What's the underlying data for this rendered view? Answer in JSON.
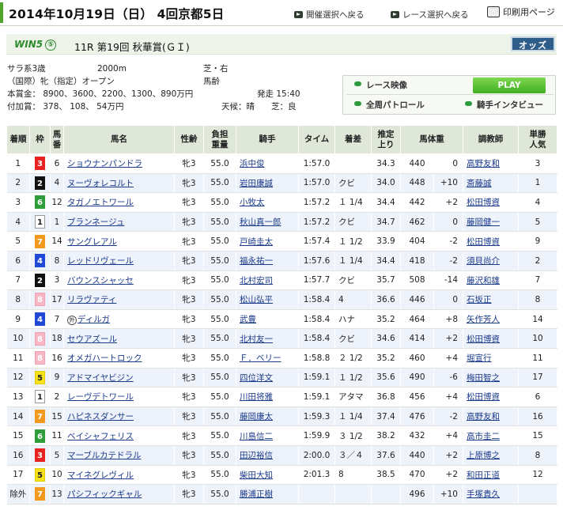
{
  "header": {
    "title": "2014年10月19日（日） 4回京都5日",
    "nav": [
      "開催選択へ戻る",
      "レース選択へ戻る"
    ],
    "print_label": "印刷用ページ"
  },
  "race": {
    "win5_label": "WIN5",
    "win5_num": "⑤",
    "name": "11R 第19回 秋華賞(ＧＩ)",
    "odds_label": "オッズ"
  },
  "info": {
    "line1": [
      "サラ系3歳",
      "2000m",
      "芝・右"
    ],
    "line2": [
      "（国際）牝（指定）オープン",
      "馬齢"
    ],
    "line3": [
      "本賞金：  8900、3600、2200、1300、890万円",
      "発走 15:40"
    ],
    "line4": [
      "付加賞：  378、  108、    54万円",
      "天候：晴",
      "芝：良"
    ]
  },
  "buttons": {
    "video": "レース映像",
    "play": "PLAY",
    "patrol": "全周パトロール",
    "interview": "騎手インタビュー"
  },
  "table": {
    "headers": [
      "着順",
      "枠",
      "馬番",
      "馬名",
      "性齢",
      "負担重量",
      "騎手",
      "タイム",
      "着差",
      "推定上り",
      "馬体重",
      "",
      "調教師",
      "単勝人気"
    ],
    "rows": [
      {
        "rank": "1",
        "waku": "3",
        "num": "6",
        "horse": "ショウナンパンドラ",
        "sex": "牝3",
        "wt": "55.0",
        "jockey": "浜中俊",
        "time": "1:57.0",
        "margin": "",
        "agari": "34.3",
        "bw": "440",
        "diff": "0",
        "trainer": "高野友和",
        "pop": "3"
      },
      {
        "rank": "2",
        "waku": "2",
        "num": "4",
        "horse": "ヌーヴォレコルト",
        "sex": "牝3",
        "wt": "55.0",
        "jockey": "岩田康誠",
        "time": "1:57.0",
        "margin": "クビ",
        "agari": "34.0",
        "bw": "448",
        "diff": "+10",
        "trainer": "斎藤誠",
        "pop": "1"
      },
      {
        "rank": "3",
        "waku": "6",
        "num": "12",
        "horse": "タガノエトワール",
        "sex": "牝3",
        "wt": "55.0",
        "jockey": "小牧太",
        "time": "1:57.2",
        "margin": "１ 1/4",
        "agari": "34.4",
        "bw": "442",
        "diff": "+2",
        "trainer": "松田博資",
        "pop": "4"
      },
      {
        "rank": "4",
        "waku": "1",
        "num": "1",
        "horse": "ブランネージュ",
        "sex": "牝3",
        "wt": "55.0",
        "jockey": "秋山真一郎",
        "time": "1:57.2",
        "margin": "クビ",
        "agari": "34.7",
        "bw": "462",
        "diff": "0",
        "trainer": "藤岡健一",
        "pop": "5"
      },
      {
        "rank": "5",
        "waku": "7",
        "num": "14",
        "horse": "サングレアル",
        "sex": "牝3",
        "wt": "55.0",
        "jockey": "戸崎圭太",
        "time": "1:57.4",
        "margin": "１ 1/2",
        "agari": "33.9",
        "bw": "404",
        "diff": "-2",
        "trainer": "松田博資",
        "pop": "9"
      },
      {
        "rank": "6",
        "waku": "4",
        "num": "8",
        "horse": "レッドリヴェール",
        "sex": "牝3",
        "wt": "55.0",
        "jockey": "福永祐一",
        "time": "1:57.6",
        "margin": "１ 1/4",
        "agari": "34.4",
        "bw": "418",
        "diff": "-2",
        "trainer": "須貝尚介",
        "pop": "2"
      },
      {
        "rank": "7",
        "waku": "2",
        "num": "3",
        "horse": "バウンスシャッセ",
        "sex": "牝3",
        "wt": "55.0",
        "jockey": "北村宏司",
        "time": "1:57.7",
        "margin": "クビ",
        "agari": "35.7",
        "bw": "508",
        "diff": "-14",
        "trainer": "藤沢和雄",
        "pop": "7"
      },
      {
        "rank": "8",
        "waku": "8",
        "num": "17",
        "horse": "リラヴァティ",
        "sex": "牝3",
        "wt": "55.0",
        "jockey": "松山弘平",
        "time": "1:58.4",
        "margin": "4",
        "agari": "36.6",
        "bw": "446",
        "diff": "0",
        "trainer": "石坂正",
        "pop": "8"
      },
      {
        "rank": "9",
        "waku": "4",
        "num": "7",
        "horse": "ディルガ",
        "foreign": "外",
        "sex": "牝3",
        "wt": "55.0",
        "jockey": "武豊",
        "time": "1:58.4",
        "margin": "ハナ",
        "agari": "35.2",
        "bw": "464",
        "diff": "+8",
        "trainer": "矢作芳人",
        "pop": "14"
      },
      {
        "rank": "10",
        "waku": "8",
        "num": "18",
        "horse": "セウアズール",
        "sex": "牝3",
        "wt": "55.0",
        "jockey": "北村友一",
        "time": "1:58.4",
        "margin": "クビ",
        "agari": "34.6",
        "bw": "414",
        "diff": "+2",
        "trainer": "松田博資",
        "pop": "10"
      },
      {
        "rank": "11",
        "waku": "8",
        "num": "16",
        "horse": "オメガハートロック",
        "sex": "牝3",
        "wt": "55.0",
        "jockey": "Ｆ．ベリー",
        "time": "1:58.8",
        "margin": "２ 1/2",
        "agari": "35.2",
        "bw": "460",
        "diff": "+4",
        "trainer": "堀宣行",
        "pop": "11"
      },
      {
        "rank": "12",
        "waku": "5",
        "num": "9",
        "horse": "アドマイヤビジン",
        "sex": "牝3",
        "wt": "55.0",
        "jockey": "四位洋文",
        "time": "1:59.1",
        "margin": "１ 1/2",
        "agari": "35.6",
        "bw": "490",
        "diff": "-6",
        "trainer": "梅田智之",
        "pop": "17"
      },
      {
        "rank": "13",
        "waku": "1",
        "num": "2",
        "horse": "レーヴデトワール",
        "sex": "牝3",
        "wt": "55.0",
        "jockey": "川田将雅",
        "time": "1:59.1",
        "margin": "アタマ",
        "agari": "36.8",
        "bw": "456",
        "diff": "+4",
        "trainer": "松田博資",
        "pop": "6"
      },
      {
        "rank": "14",
        "waku": "7",
        "num": "15",
        "horse": "ハピネスダンサー",
        "sex": "牝3",
        "wt": "55.0",
        "jockey": "藤岡康太",
        "time": "1:59.3",
        "margin": "１ 1/4",
        "agari": "37.4",
        "bw": "476",
        "diff": "-2",
        "trainer": "高野友和",
        "pop": "16"
      },
      {
        "rank": "15",
        "waku": "6",
        "num": "11",
        "horse": "ベイシャフェリス",
        "sex": "牝3",
        "wt": "55.0",
        "jockey": "川島信二",
        "time": "1:59.9",
        "margin": "３ 1/2",
        "agari": "38.2",
        "bw": "432",
        "diff": "+4",
        "trainer": "高市圭二",
        "pop": "15"
      },
      {
        "rank": "16",
        "waku": "3",
        "num": "5",
        "horse": "マーブルカテドラル",
        "sex": "牝3",
        "wt": "55.0",
        "jockey": "田辺裕信",
        "time": "2:00.0",
        "margin": "３／４",
        "agari": "37.6",
        "bw": "440",
        "diff": "+2",
        "trainer": "上原博之",
        "pop": "8"
      },
      {
        "rank": "17",
        "waku": "5",
        "num": "10",
        "horse": "マイネグレヴィル",
        "sex": "牝3",
        "wt": "55.0",
        "jockey": "柴田大知",
        "time": "2:01.3",
        "margin": "8",
        "agari": "38.5",
        "bw": "470",
        "diff": "+2",
        "trainer": "和田正道",
        "pop": "12"
      },
      {
        "rank": "除外",
        "waku": "7",
        "num": "13",
        "horse": "パシフィックギャル",
        "sex": "牝3",
        "wt": "55.0",
        "jockey": "勝浦正樹",
        "time": "",
        "margin": "",
        "agari": "",
        "bw": "496",
        "diff": "+10",
        "trainer": "手塚貴久",
        "pop": ""
      }
    ]
  },
  "waku_colors": {
    "1": {
      "bg": "#ffffff",
      "fg": "#222222",
      "border": "#999999"
    },
    "2": {
      "bg": "#111111",
      "fg": "#ffffff",
      "border": "#111111"
    },
    "3": {
      "bg": "#e8231f",
      "fg": "#ffffff",
      "border": "#e8231f"
    },
    "4": {
      "bg": "#1f49d6",
      "fg": "#ffffff",
      "border": "#1f49d6"
    },
    "5": {
      "bg": "#f5e21a",
      "fg": "#222222",
      "border": "#e0cc00"
    },
    "6": {
      "bg": "#2f9e3a",
      "fg": "#ffffff",
      "border": "#2f9e3a"
    },
    "7": {
      "bg": "#f39a1e",
      "fg": "#ffffff",
      "border": "#f39a1e"
    },
    "8": {
      "bg": "#f7b7c5",
      "fg": "#ffffff",
      "border": "#f0a0b2"
    }
  }
}
